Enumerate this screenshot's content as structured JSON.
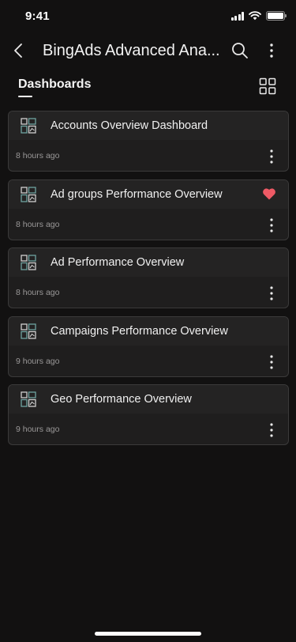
{
  "status_bar": {
    "time": "9:41"
  },
  "header": {
    "title": "BingAds Advanced Ana..."
  },
  "tabs": {
    "dashboards_label": "Dashboards"
  },
  "colors": {
    "background": "#121111",
    "card": "#1f1e1e",
    "card_header": "#242323",
    "favorite": "#ee5a65",
    "icon_accent": "#6fa3a0"
  },
  "dashboards": [
    {
      "title": "Accounts Overview Dashboard",
      "updated": "8 hours ago",
      "favorite": false
    },
    {
      "title": "Ad groups Performance Overview",
      "updated": "8 hours ago",
      "favorite": true
    },
    {
      "title": "Ad Performance Overview",
      "updated": "8 hours ago",
      "favorite": false
    },
    {
      "title": "Campaigns Performance Overview",
      "updated": "9 hours ago",
      "favorite": false
    },
    {
      "title": "Geo Performance Overview",
      "updated": "9 hours ago",
      "favorite": false
    }
  ]
}
